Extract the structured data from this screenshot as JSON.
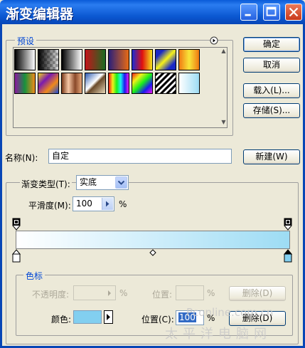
{
  "window": {
    "title": "渐变编辑器"
  },
  "presets": {
    "legend": "预设",
    "swatches": [
      {
        "name": "foreground-to-background",
        "css": "linear-gradient(to right, #000, #fff)"
      },
      {
        "name": "foreground-to-transparent",
        "css": "linear-gradient(to right, #000, rgba(0,0,0,0.15)), repeating-conic-gradient(#bbb 0% 25%, #fff 0% 50%) 0 0/8px 8px"
      },
      {
        "name": "black-white",
        "css": "linear-gradient(to right, #000, #fff)"
      },
      {
        "name": "red-green",
        "css": "linear-gradient(to right, #c4141a, #1a6c22)"
      },
      {
        "name": "violet-orange",
        "css": "linear-gradient(to right, #2a1f7a, #e86a14)"
      },
      {
        "name": "blue-red-yellow",
        "css": "linear-gradient(to right, #1a2cd6, #e01010, #f6e41a)"
      },
      {
        "name": "blue-yellow-blue",
        "css": "linear-gradient(135deg, #1a28c6 20%, #f6f21a 50%, #1a28c6 80%)"
      },
      {
        "name": "orange-yellow-orange",
        "css": "linear-gradient(to right, #f07a12, #f8e63a, #f07a12)"
      },
      {
        "name": "violet-green-orange",
        "css": "linear-gradient(to right, #8a1aa0, #18923c, #f08a1a)"
      },
      {
        "name": "yellow-violet-orange-blue",
        "css": "linear-gradient(135deg, #f0d81a, #7a1ab0, #f08a1a, #1a4ad6)"
      },
      {
        "name": "copper",
        "css": "linear-gradient(to right, #7a3a1a, #f6c8a6, #8a4a2a, #e6a67a)"
      },
      {
        "name": "chrome",
        "css": "linear-gradient(135deg, #2a5ab0 0%, #ffffff 45%, #6a4a2a 55%, #e8d8b8 100%)"
      },
      {
        "name": "spectrum",
        "css": "linear-gradient(to right, #f01a1a, #f0f01a, #1af01a, #1af0f0, #1a1af0, #f01af0)"
      },
      {
        "name": "transparent-rainbow",
        "css": "linear-gradient(135deg, #f01a1a, #f0f01a, #1af01a, #1a1af0, #f01af0)"
      },
      {
        "name": "transparent-stripes",
        "css": "repeating-linear-gradient(135deg, #000 0 3px, #fff 3px 6px)"
      },
      {
        "name": "light-blue",
        "css": "linear-gradient(to right, #ffffff, #9ddcf4)"
      }
    ]
  },
  "buttons": {
    "ok": "确定",
    "cancel": "取消",
    "load": "载入(L)...",
    "save": "存储(S)...",
    "new": "新建(W)",
    "delete_opacity": "删除(D)",
    "delete_color": "删除(D)"
  },
  "name_row": {
    "label": "名称(N):",
    "value": "自定"
  },
  "gradient": {
    "type_label": "渐变类型(T):",
    "type_value": "实底",
    "smoothness_label": "平滑度(M):",
    "smoothness_value": "100",
    "smoothness_unit": "%",
    "end_color": "#9ddcf4",
    "start_color": "#ffffff"
  },
  "stops": {
    "legend": "色标",
    "opacity_label": "不透明度:",
    "opacity_unit": "%",
    "opacity_location_label": "位置:",
    "opacity_location_unit": "%",
    "color_label": "颜色:",
    "color_location_label": "位置(C):",
    "color_location_value": "100",
    "color_location_unit": "%",
    "color_value": "#82cff0"
  },
  "watermark": {
    "line1": "Pconline.com.cn",
    "line2": "太平洋电脑网"
  }
}
